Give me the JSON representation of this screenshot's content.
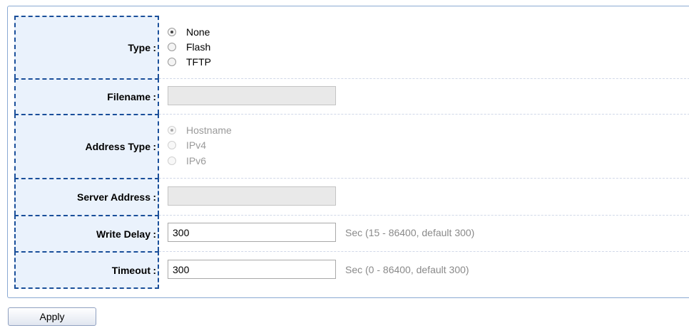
{
  "form": {
    "type": {
      "label": "Type",
      "options": [
        {
          "label": "None",
          "checked": true,
          "disabled": false
        },
        {
          "label": "Flash",
          "checked": false,
          "disabled": false
        },
        {
          "label": "TFTP",
          "checked": false,
          "disabled": false
        }
      ]
    },
    "filename": {
      "label": "Filename",
      "value": "",
      "disabled": true
    },
    "address_type": {
      "label": "Address Type",
      "options": [
        {
          "label": "Hostname",
          "checked": true,
          "disabled": true
        },
        {
          "label": "IPv4",
          "checked": false,
          "disabled": true
        },
        {
          "label": "IPv6",
          "checked": false,
          "disabled": true
        }
      ]
    },
    "server_address": {
      "label": "Server Address",
      "value": "",
      "disabled": true
    },
    "write_delay": {
      "label": "Write Delay",
      "value": "300",
      "hint": "Sec (15 - 86400, default 300)"
    },
    "timeout": {
      "label": "Timeout",
      "value": "300",
      "hint": "Sec (0 - 86400, default 300)"
    }
  },
  "colon": ":",
  "apply_label": "Apply"
}
